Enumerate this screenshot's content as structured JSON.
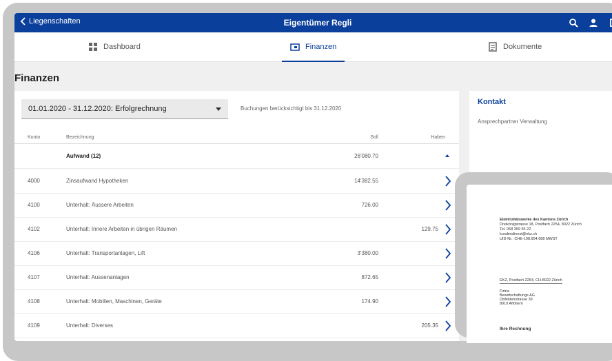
{
  "header": {
    "back_label": "Liegenschaften",
    "title": "Eigentümer Regli"
  },
  "tabs": [
    {
      "label": "Dashboard",
      "active": false
    },
    {
      "label": "Finanzen",
      "active": true
    },
    {
      "label": "Dokumente",
      "active": false
    }
  ],
  "page_title": "Finanzen",
  "period_select": {
    "value": "01.01.2020 - 31.12.2020: Erfolgrechnung"
  },
  "note": "Buchungen berücksichtigt bis 31.12.2020",
  "table": {
    "headers": {
      "konto": "Konto",
      "bezeichnung": "Bezeichnung",
      "soll": "Soll",
      "haben": "Haben"
    },
    "group": {
      "label": "Aufwand (12)",
      "soll": "26'080.70"
    },
    "rows": [
      {
        "konto": "4000",
        "bezeichnung": "Zinsaufwand Hypotheken",
        "soll": "14'382.55",
        "haben": ""
      },
      {
        "konto": "4100",
        "bezeichnung": "Unterhalt: Äussere Arbeiten",
        "soll": "726.00",
        "haben": ""
      },
      {
        "konto": "4102",
        "bezeichnung": "Unterhalt: Innere Arbeiten in übrigen Räumen",
        "soll": "",
        "haben": "129.75"
      },
      {
        "konto": "4106",
        "bezeichnung": "Unterhalt: Transportanlagen, Lift",
        "soll": "3'380.00",
        "haben": ""
      },
      {
        "konto": "4107",
        "bezeichnung": "Unterhalt: Aussenanlagen",
        "soll": "872.65",
        "haben": ""
      },
      {
        "konto": "4108",
        "bezeichnung": "Unterhalt: Mobilien, Maschinen, Geräte",
        "soll": "174.90",
        "haben": ""
      },
      {
        "konto": "4109",
        "bezeichnung": "Unterhalt: Diverses",
        "soll": "",
        "haben": "205.35"
      }
    ]
  },
  "contact": {
    "title": "Kontakt",
    "subtitle": "Ansprechpartner Verwaltung"
  },
  "document": {
    "sender_name": "Elektrizitätswerke des Kantons Zürich",
    "sender_addr": "Dreikönigstrasse 18, Postfach 2254, 8022 Zürich",
    "sender_tel": "Tel. 058 359 55 22",
    "sender_mail": "kundendienst@ekz.ch",
    "sender_uid": "UID-Nr.: CHE-108.954.688 MWST",
    "return_line": "EKZ, Postfach 2254, CH-8022 Zürich",
    "recipient": [
      "Firma",
      "Bewirtschaftungs AG",
      "Obfeldenstrasse 39",
      "8910 Affoltern"
    ],
    "heading": "Ihre Rechnung"
  },
  "colors": {
    "primary": "#0b3f9c"
  }
}
